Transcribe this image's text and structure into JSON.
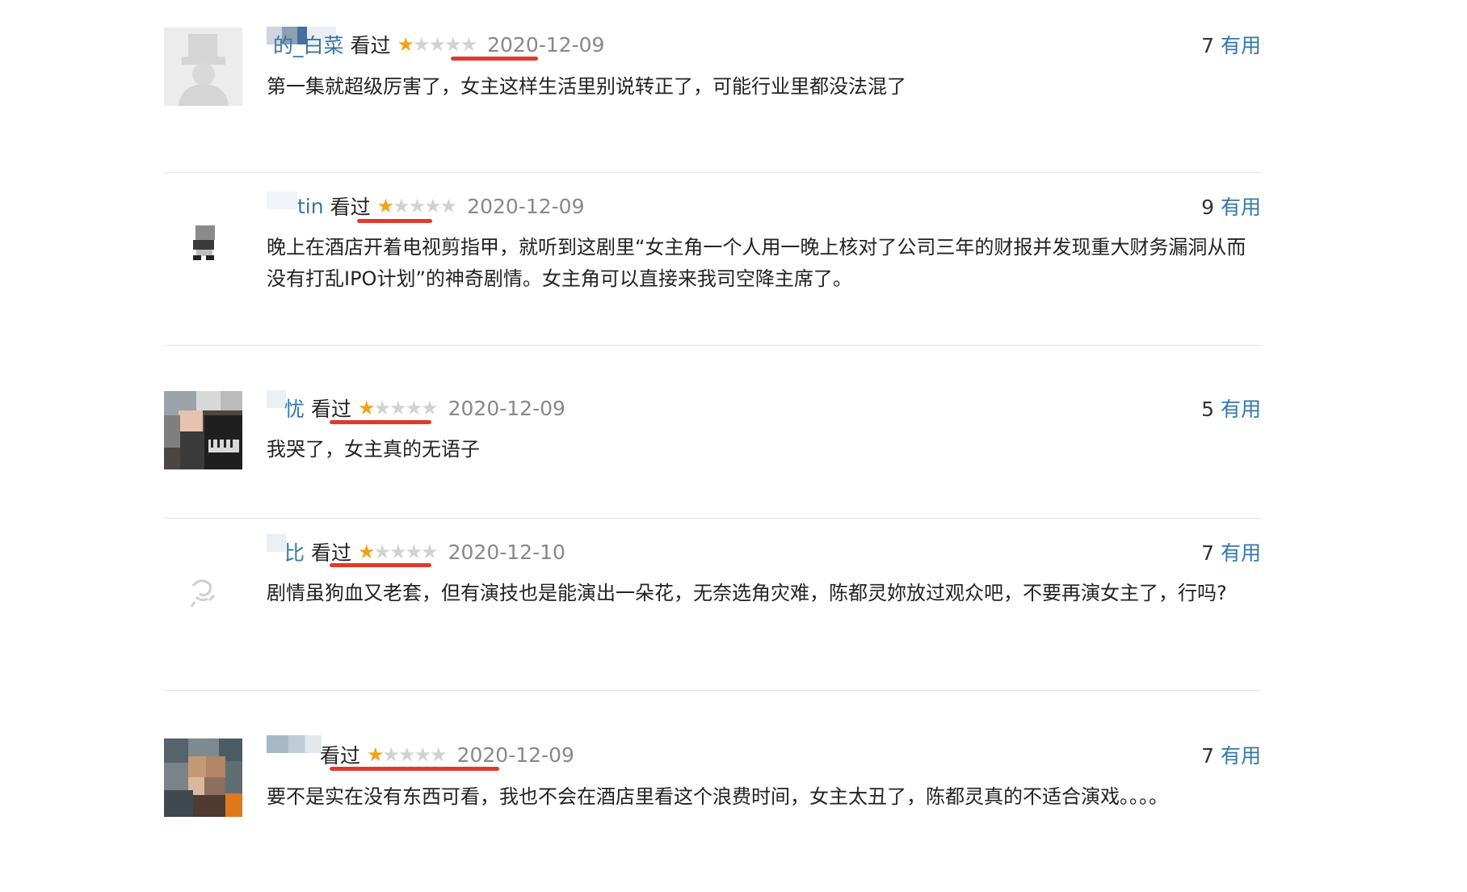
{
  "reviews": [
    {
      "username": "的_白菜",
      "status": "看过",
      "rating": 1,
      "date": "2020-12-09",
      "votes": "7",
      "useful_label": "有用",
      "content": "第一集就超级厉害了，女主这样生活里别说转正了，可能行业里都没法混了",
      "avatar": "default-silhouette"
    },
    {
      "username": "tin",
      "status": "看过",
      "rating": 1,
      "date": "2020-12-09",
      "votes": "9",
      "useful_label": "有用",
      "content": "晚上在酒店开着电视剪指甲，就听到这剧里“女主角一个人用一晚上核对了公司三年的财报并发现重大财务漏洞从而没有打乱IPO计划”的神奇剧情。女主角可以直接来我司空降主席了。",
      "avatar": "small-icon"
    },
    {
      "username": "忧",
      "status": "看过",
      "rating": 1,
      "date": "2020-12-09",
      "votes": "5",
      "useful_label": "有用",
      "content": "我哭了，女主真的无语子",
      "avatar": "photo-piano-blurred"
    },
    {
      "username": "比",
      "status": "看过",
      "rating": 1,
      "date": "2020-12-10",
      "votes": "7",
      "useful_label": "有用",
      "content": "剧情虽狗血又老套，但有演技也是能演出一朵花，无奈选角灾难，陈都灵妳放过观众吧，不要再演女主了，行吗?",
      "avatar": "sketch-faint"
    },
    {
      "username": "",
      "status": "看过",
      "rating": 1,
      "date": "2020-12-09",
      "votes": "7",
      "useful_label": "有用",
      "content": "要不是实在没有东西可看，我也不会在酒店里看这个浪费时间，女主太丑了，陈都灵真的不适合演戏。。。。",
      "avatar": "photo-portrait-blurred"
    }
  ],
  "colors": {
    "link": "#3377aa",
    "star_on": "#f2a21a",
    "star_off": "#d2d2d2",
    "underline": "#e23a2a",
    "divider": "#e4e4e4"
  }
}
